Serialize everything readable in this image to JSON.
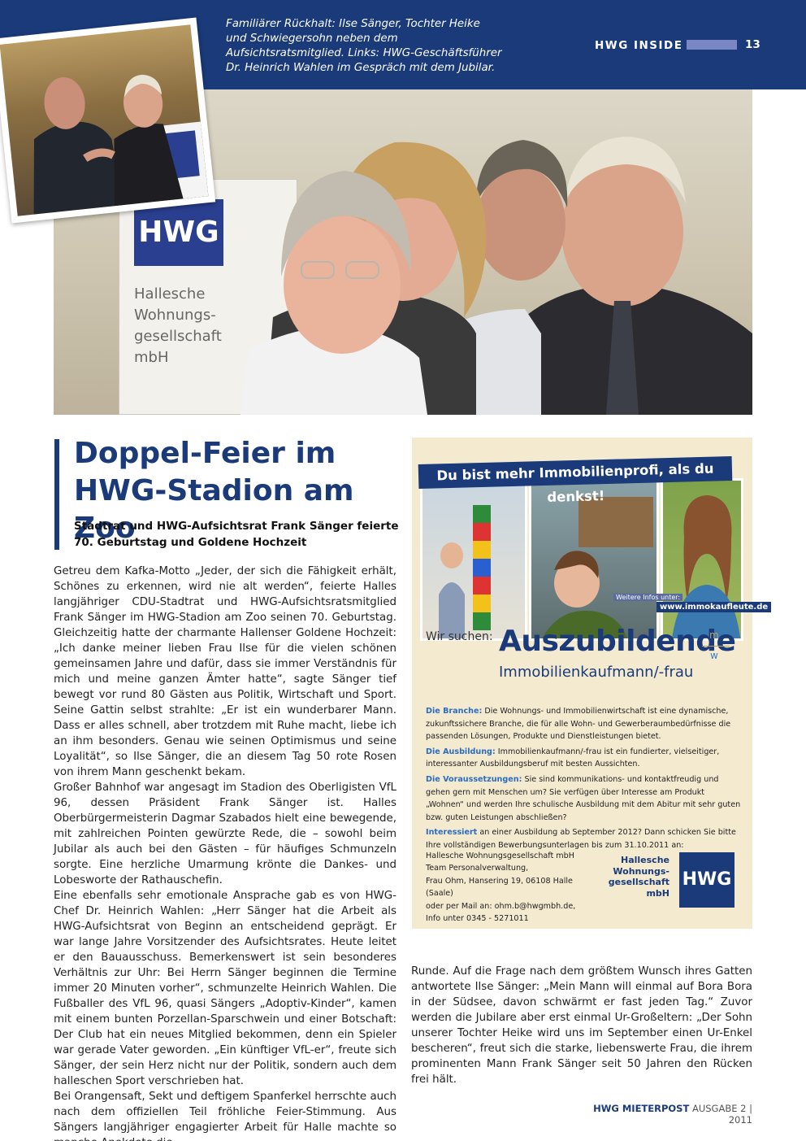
{
  "header": {
    "caption": "Familiärer Rückhalt: Ilse Sänger, Tochter Heike und Schwiegersohn neben dem Aufsichtsratsmitglied. Links: HWG-Geschäftsführer Dr. Heinrich Wahlen im Gespräch mit dem Jubilar.",
    "section": "HWG INSIDE",
    "page": "13"
  },
  "photo": {
    "banner_logo": "HWG",
    "banner_text": "Hallesche\nWohnungs-\ngesellschaft\nmbH"
  },
  "article": {
    "headline": "Doppel-Feier im HWG-Stadion am Zoo",
    "subhead": "Stadtrat und HWG-Aufsichtsrat Frank Sänger feierte 70. Geburtstag und Goldene Hochzeit",
    "col1": [
      "Getreu dem Kafka-Motto „Jeder, der sich die Fähigkeit erhält, Schönes zu erkennen, wird nie alt werden“, feierte Halles langjähriger CDU-Stadtrat und HWG-Aufsichtsratsmitglied Frank Sänger im HWG-Stadion am Zoo seinen 70. Geburtstag. Gleichzeitig hatte der charmante Hallenser Goldene Hochzeit: „Ich danke meiner lieben Frau Ilse für die vielen schönen gemeinsamen Jahre und dafür, dass sie immer Verständnis für mich und meine ganzen Ämter hatte“, sagte Sänger tief bewegt vor rund 80 Gästen aus Politik, Wirtschaft und Sport. Seine Gattin selbst strahlte: „Er ist ein wunderbarer Mann. Dass er alles schnell, aber trotzdem mit Ruhe macht, liebe ich an ihm besonders. Genau wie seinen Optimismus und seine Loyalität“, so Ilse Sänger, die an diesem Tag 50 rote Rosen von ihrem Mann geschenkt bekam.",
      "Großer Bahnhof war angesagt im Stadion des Oberligisten VfL 96, dessen Präsident Frank Sänger ist. Halles Oberbürgermeisterin Dagmar Szabados hielt eine bewegende, mit zahlreichen Pointen gewürzte Rede, die – sowohl beim Jubilar als auch bei den Gästen – für häufiges Schmunzeln sorgte. Eine herzliche Umarmung krönte die Dankes- und Lobesworte der Rathauschefin.",
      "Eine ebenfalls sehr emotionale Ansprache gab es von HWG-Chef Dr. Heinrich Wahlen: „Herr Sänger hat die Arbeit als HWG-Aufsichtsrat von Beginn an entscheidend geprägt. Er war lange Jahre Vorsitzender des Aufsichtsrates. Heute leitet er den Bauausschuss. Bemerkenswert ist sein besonderes Verhältnis zur Uhr: Bei Herrn Sänger beginnen die Termine immer 20 Minuten vorher“, schmunzelte Heinrich Wahlen. Die Fußballer des VfL 96, quasi Sängers „Adoptiv-Kinder“, kamen mit einem bunten Porzellan-Sparschwein und einer Botschaft: Der Club hat ein neues Mitglied bekommen, denn ein Spieler war gerade Vater geworden. „Ein künftiger VfL-er“, freute sich Sänger, der sein Herz nicht nur der Politik, sondern auch dem halleschen Sport verschrieben hat.",
      "Bei Orangensaft, Sekt und deftigem Spanferkel herrschte auch nach dem offiziellen Teil fröhliche Feier-Stimmung. Aus Sängers langjähriger engagierter Arbeit für Halle machte so manche Anekdote die"
    ],
    "col2": "Runde. Auf die Frage nach dem größtem Wunsch ihres Gatten antwortete Ilse Sänger: „Mein Mann will einmal auf Bora Bora in der Südsee, davon schwärmt er fast jeden Tag.“ Zuvor werden die Jubilare aber erst einmal Ur-Großeltern: „Der Sohn unserer Tochter Heike wird uns im September einen Ur-Enkel bescheren“, freut sich die starke, liebenswerte Frau, die ihrem prominenten Mann Frank Sänger seit 50 Jahren den Rücken frei hält."
  },
  "ad": {
    "banner": "Du bist mehr Immobilienprofi, als du denkst!",
    "url_prefix": "Weitere Infos unter:",
    "url": "www.immokaufleute.de",
    "seek": "Wir suchen:",
    "title": "Auszubildende",
    "subtitle": "Immobilienkaufmann/-frau",
    "m": "m",
    "w": "w",
    "details": [
      {
        "key": "Die Branche:",
        "text": " Die Wohnungs- und Immobilienwirtschaft ist eine dynamische, zukunftssichere Branche, die für alle Wohn- und Gewerberaumbedürfnisse die passenden Lösungen, Produkte und Dienstleistungen bietet."
      },
      {
        "key": "Die Ausbildung:",
        "text": " Immobilienkaufmann/-frau ist ein fundierter, vielseitiger, interessanter Ausbildungsberuf mit besten Aussichten."
      },
      {
        "key": "Die Voraussetzungen:",
        "text": " Sie sind kommunikations- und kontaktfreudig und gehen gern mit Menschen um? Sie verfügen über Interesse am Produkt „Wohnen“ und werden Ihre schulische Ausbildung mit dem Abitur mit sehr guten bzw. guten Leistungen abschließen?"
      },
      {
        "key": "Interessiert",
        "text": " an einer Ausbildung ab September 2012? Dann schicken Sie bitte Ihre vollständigen Bewerbungsunterlagen bis zum 31.10.2011 an:"
      }
    ],
    "contact": "Hallesche Wohnungsgesellschaft mbH\nTeam Personalverwaltung,\nFrau Ohm, Hansering 19, 06108 Halle (Saale)\noder per Mail an: ohm.b@hwgmbh.de,\nInfo unter 0345 - 5271011",
    "company": "Hallesche\nWohnungs-\ngesellschaft\nmbH",
    "logo": "HWG"
  },
  "footer": {
    "publication": "HWG MIETERPOST",
    "issue": "AUSGABE 2 | 2011"
  },
  "colors": {
    "brand_blue": "#1a3a7a",
    "ad_background": "#f4ead0",
    "ad_key": "#2a6cc0"
  }
}
